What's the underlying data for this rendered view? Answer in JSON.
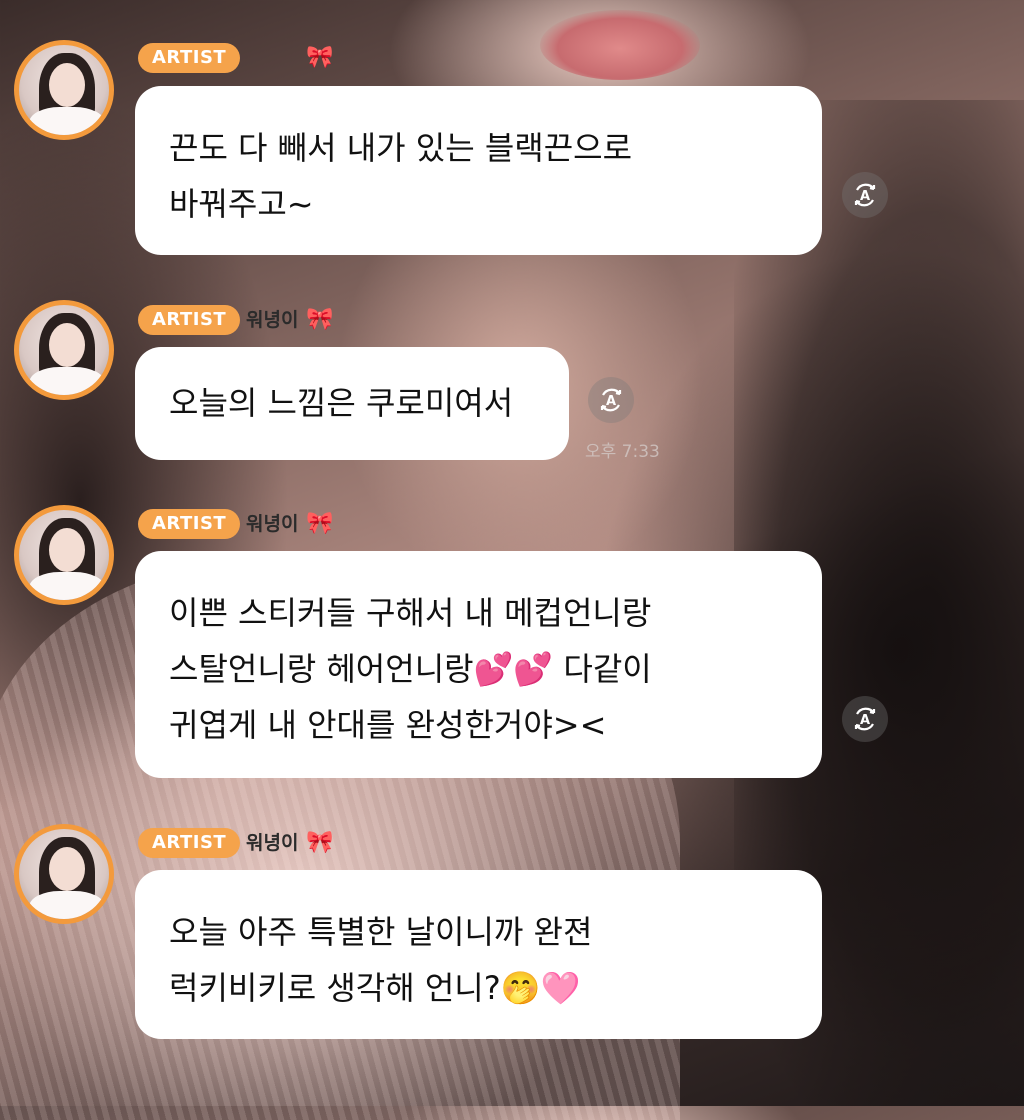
{
  "messages": [
    {
      "badge": "ARTIST",
      "name": "",
      "bow": "🎀",
      "lines": [
        "끈도 다 빼서 내가 있는 블랙끈으로",
        "바꿔주고~"
      ],
      "time": ""
    },
    {
      "badge": "ARTIST",
      "name": "워녕이",
      "bow": "🎀",
      "lines": [
        "오늘의 느낌은 쿠로미여서"
      ],
      "time": "오후 7:33"
    },
    {
      "badge": "ARTIST",
      "name": "워녕이",
      "bow": "🎀",
      "lines": [
        "이쁜 스티커들 구해서 내 메컵언니랑",
        "스탈언니랑 헤어언니랑💕💕 다같이",
        "귀엽게 내 안대를 완성한거야><"
      ],
      "time": ""
    },
    {
      "badge": "ARTIST",
      "name": "워녕이",
      "bow": "🎀",
      "lines": [
        "오늘 아주 특별한 날이니까 완젼",
        "럭키비키로 생각해 언니?🤭🩷"
      ],
      "time": ""
    }
  ],
  "icons": {
    "translate": "translate-icon",
    "bow": "ribbon-bow-icon",
    "avatar": "profile-avatar"
  },
  "colors": {
    "badge": "#f5a34b",
    "avatar_ring": "#f39a3c",
    "bubble": "#ffffff",
    "text": "#111111"
  }
}
